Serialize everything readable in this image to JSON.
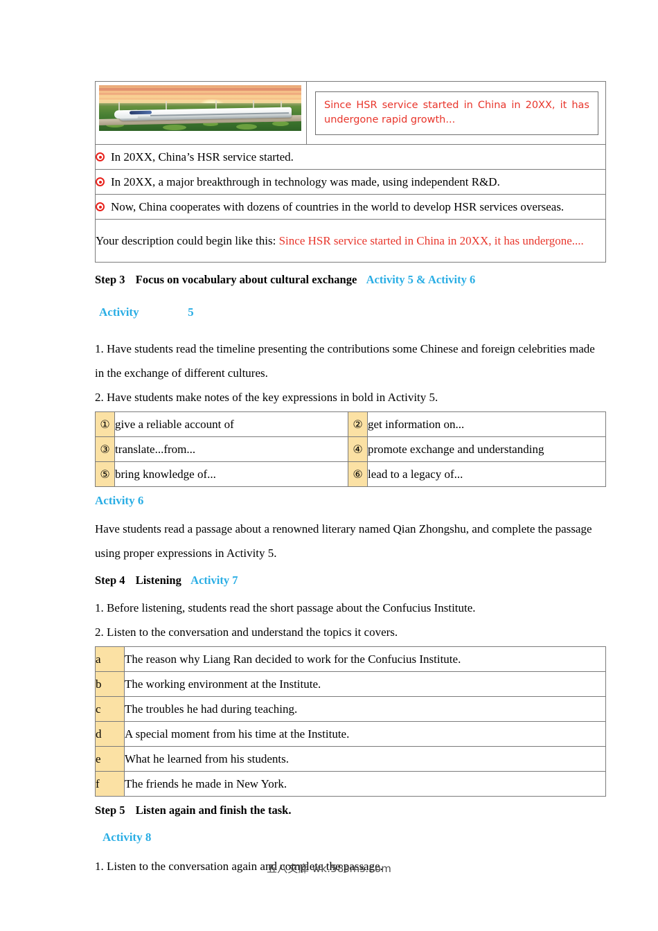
{
  "hsr_table": {
    "photo_alt": "high-speed-train-at-sunset",
    "quote": "Since HSR service started in China in 20XX, it has undergone rapid growth...",
    "bullets": [
      "In 20XX, China’s HSR service started.",
      "In 20XX, a major breakthrough in technology was made, using independent R&D.",
      "Now, China cooperates with dozens of countries in the world to develop HSR services overseas."
    ],
    "description_prompt": "Your description could begin like this:",
    "description_sample": "Since HSR service started in China in 20XX, it has undergone...."
  },
  "step3": {
    "label": "Step 3",
    "title": "Focus on vocabulary about cultural exchange",
    "activities": "Activity 5 & Activity 6"
  },
  "activity5": {
    "heading_word": "Activity",
    "heading_number": "5",
    "line1": "1. Have students read the timeline presenting the contributions some Chinese and foreign celebrities made",
    "line2": "in the exchange of different cultures.",
    "line3": "2. Have students make notes of the key expressions in bold in Activity 5."
  },
  "expressions": [
    {
      "num": "①",
      "text": "give a reliable account of"
    },
    {
      "num": "②",
      "text": "get information on..."
    },
    {
      "num": "③",
      "text": "translate...from..."
    },
    {
      "num": "④",
      "text": "promote exchange and understanding"
    },
    {
      "num": "⑤",
      "text": "bring knowledge of..."
    },
    {
      "num": "⑥",
      "text": "lead to a legacy of..."
    }
  ],
  "activity6": {
    "heading": "Activity 6",
    "line1": "Have students read a passage about a renowned literary named Qian Zhongshu, and complete the passage",
    "line2": "using proper expressions in Activity 5."
  },
  "step4": {
    "label": "Step 4",
    "title": "Listening",
    "activity": "Activity 7",
    "line1": "1. Before listening, students read the short passage about the Confucius Institute.",
    "line2": "2. Listen to the conversation and understand the topics it covers."
  },
  "topics": [
    {
      "letter": "a",
      "text": "The reason why Liang Ran decided to work for the Confucius Institute."
    },
    {
      "letter": "b",
      "text": "The working environment at the Institute."
    },
    {
      "letter": "c",
      "text": "The troubles he had during teaching."
    },
    {
      "letter": "d",
      "text": "A special moment from his time at the Institute."
    },
    {
      "letter": "e",
      "text": "What he learned from his students."
    },
    {
      "letter": "f",
      "text": "The friends he made in New York."
    }
  ],
  "step5": {
    "label": "Step 5",
    "title": "Listen again and finish the task.",
    "activity_heading": "Activity 8",
    "line1": "1. Listen to the conversation again and complete the passage."
  },
  "watermark": "五八文库 wk.58sms.com",
  "colors": {
    "accent_blue": "#29ade4",
    "accent_red": "#e8352b",
    "cell_yellow": "#fbe1a4",
    "border_gray": "#7b7b7b"
  }
}
